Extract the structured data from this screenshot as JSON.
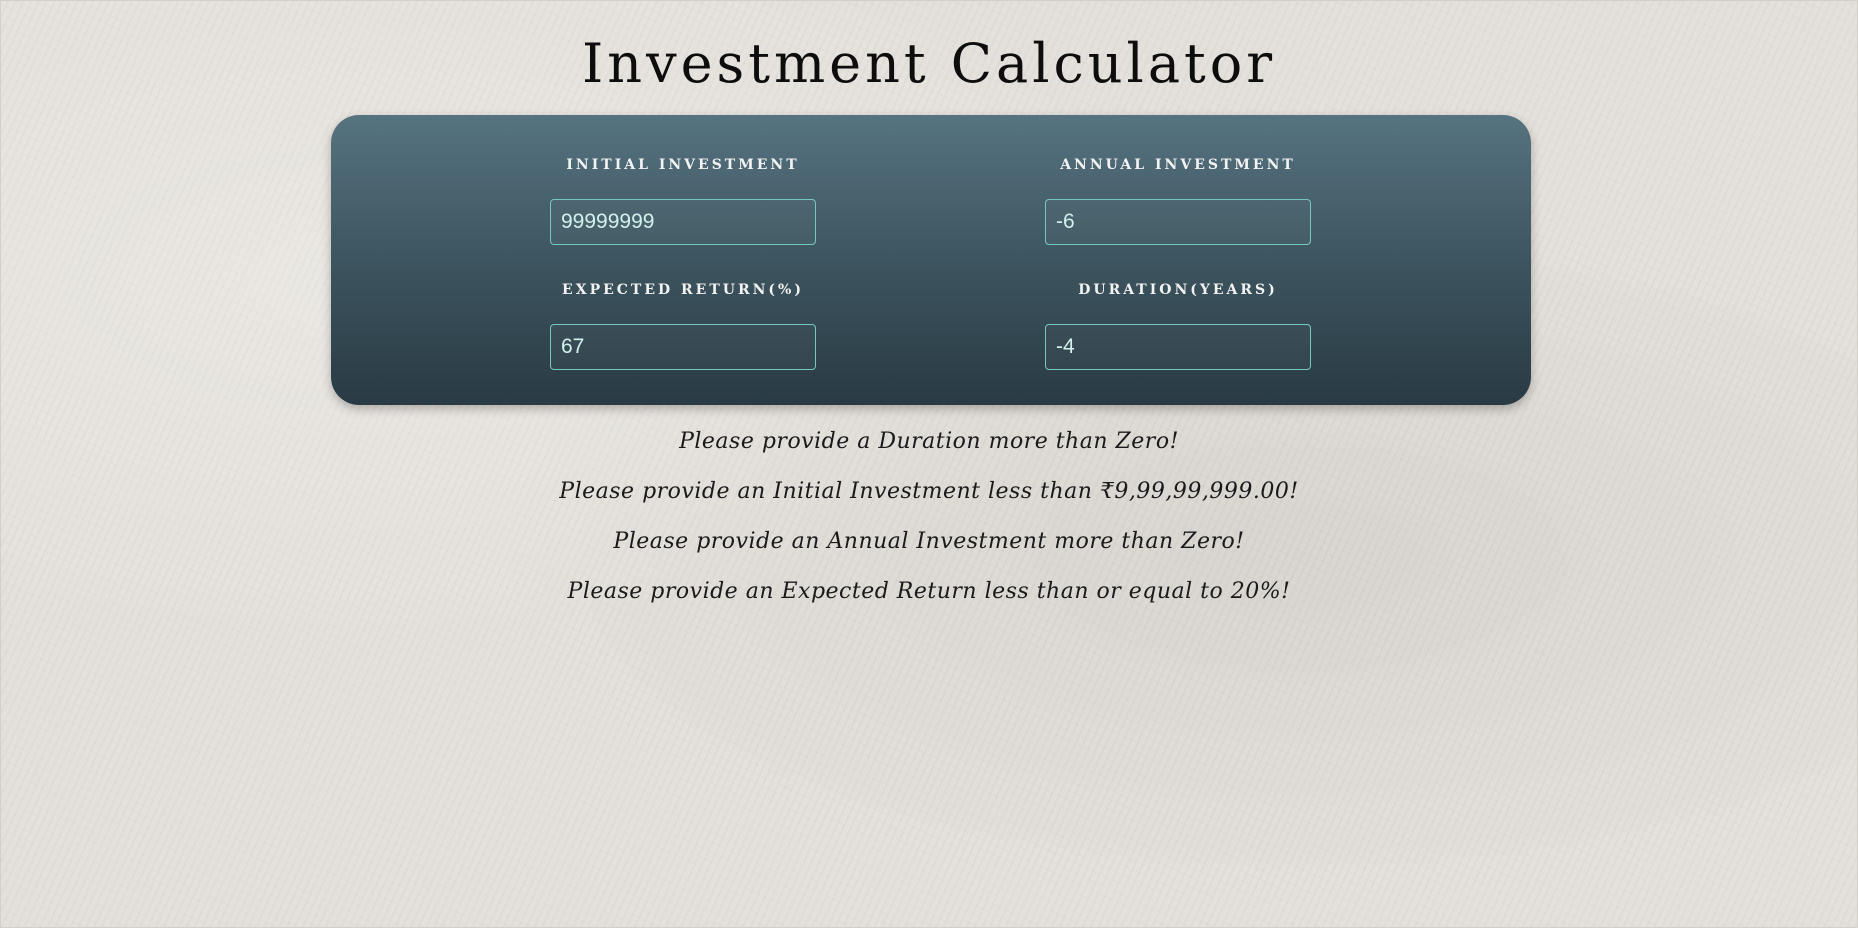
{
  "header": {
    "title": "Investment Calculator"
  },
  "form": {
    "initial_investment": {
      "label": "Initial Investment",
      "value": "99999999"
    },
    "annual_investment": {
      "label": "Annual Investment",
      "value": "-6"
    },
    "expected_return": {
      "label": "Expected Return(%)",
      "value": "67"
    },
    "duration": {
      "label": "Duration(Years)",
      "value": "-4"
    }
  },
  "messages": [
    "Please provide a Duration more than Zero!",
    "Please provide an Initial Investment less than ₹9,99,99,999.00!",
    "Please provide an Annual Investment more than Zero!",
    "Please provide an Expected Return less than or equal to 20%!"
  ],
  "colors": {
    "background": "#e4e0da",
    "panel_top": "#567380",
    "panel_bottom": "#293a43",
    "input_border": "#76c8bd",
    "input_text": "#d2f1ec"
  }
}
